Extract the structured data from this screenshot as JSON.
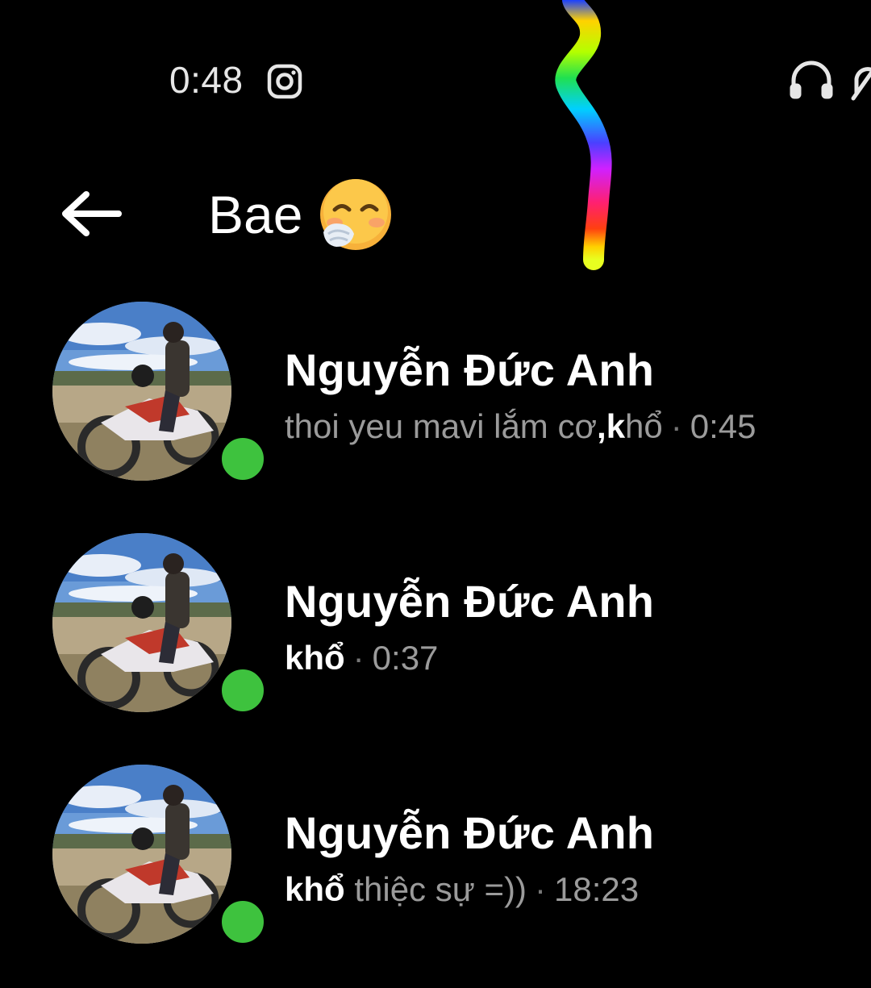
{
  "status_bar": {
    "time": "0:48",
    "left_icon": "instagram-icon",
    "right_icons": [
      "headset-icon",
      "mute-bell-icon"
    ]
  },
  "header": {
    "back_icon": "arrow-left-icon",
    "title": "Bae",
    "title_emoji": "face-with-hand-over-mouth-emoji"
  },
  "results": [
    {
      "name": "Nguyễn Đức Anh",
      "preview_prefix": "thoi yeu mavi lắm cơ",
      "preview_sep": ",",
      "preview_highlight": "k",
      "preview_suffix": "hổ",
      "time": "0:45",
      "online": true
    },
    {
      "name": "Nguyễn Đức Anh",
      "preview_prefix": "",
      "preview_sep": "",
      "preview_highlight": "khổ",
      "preview_suffix": "",
      "time": "0:37",
      "online": true
    },
    {
      "name": "Nguyễn Đức Anh",
      "preview_prefix": "",
      "preview_sep": "",
      "preview_highlight": "khổ",
      "preview_suffix": " thiệc sự =))",
      "time": "18:23",
      "online": true
    }
  ],
  "separator": "·",
  "colors": {
    "background": "#000000",
    "online": "#3ec23e",
    "secondary_text": "#9b9b9b"
  }
}
